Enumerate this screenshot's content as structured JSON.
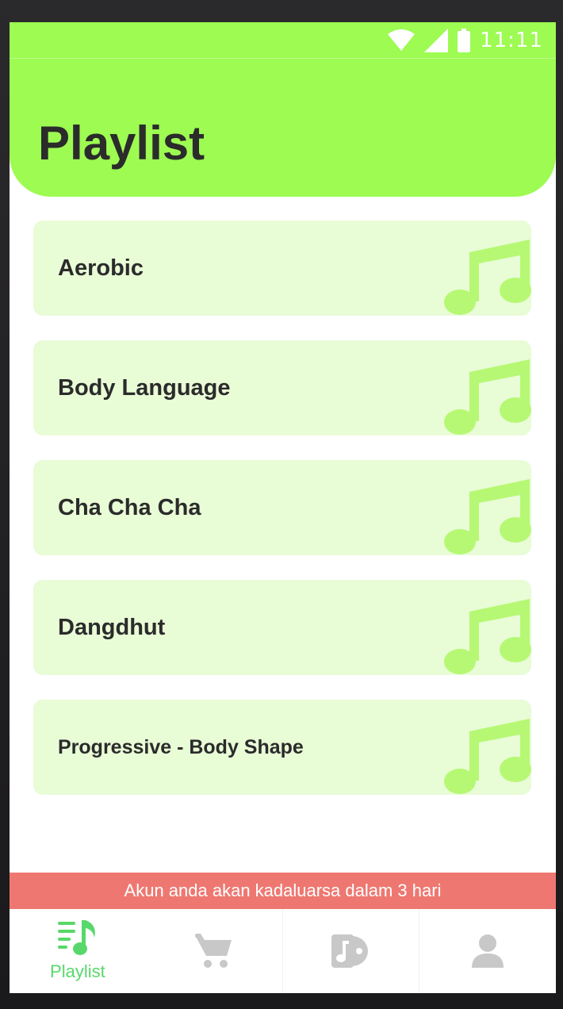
{
  "status_bar": {
    "time": "11:11"
  },
  "header": {
    "title": "Playlist"
  },
  "playlists": [
    {
      "label": "Aerobic"
    },
    {
      "label": "Body Language"
    },
    {
      "label": "Cha Cha Cha"
    },
    {
      "label": "Dangdhut"
    },
    {
      "label": "Progressive - Body Shape"
    }
  ],
  "banner": {
    "text": "Akun anda akan kadaluarsa dalam 3 hari"
  },
  "bottom_nav": {
    "items": [
      {
        "label": "Playlist",
        "icon": "playlist-icon",
        "active": true
      },
      {
        "label": "",
        "icon": "cart-icon",
        "active": false
      },
      {
        "label": "",
        "icon": "music-album-icon",
        "active": false
      },
      {
        "label": "",
        "icon": "user-icon",
        "active": false
      }
    ]
  },
  "colors": {
    "accent_green": "#9dfb52",
    "card_bg": "#e8fcd6",
    "note_green": "#b6f873",
    "banner_red": "#ee7871",
    "active_nav": "#58d86a",
    "inactive_nav": "#c8c8c8"
  }
}
